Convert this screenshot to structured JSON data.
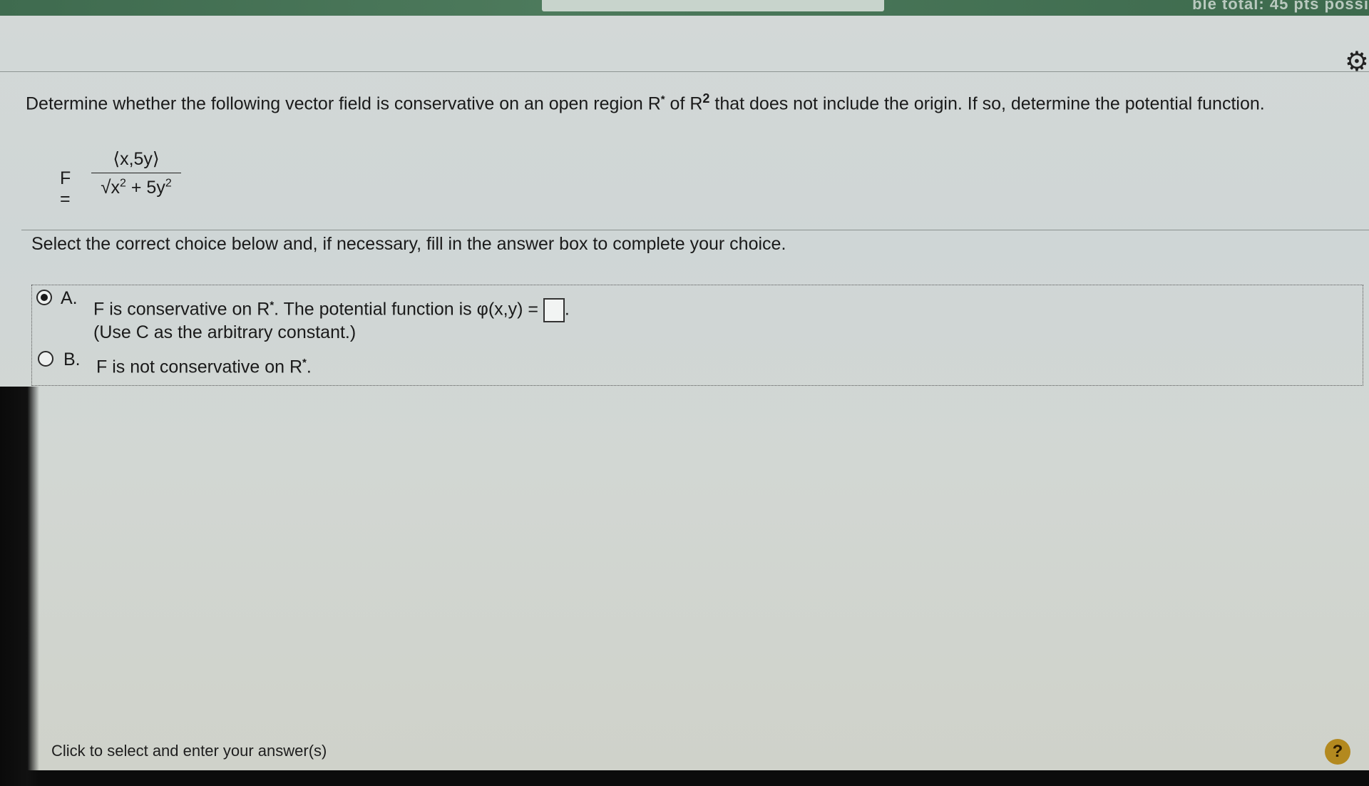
{
  "topbar": {
    "right_text": "ble total: 45 pts possi"
  },
  "question": {
    "part1": "Determine whether the following vector field is conservative on an open region R",
    "part1_sup": "*",
    "part2": " of R",
    "part2_sup": "2",
    "part3": " that does not include the origin. If so, determine the potential function."
  },
  "formula": {
    "label": "F =",
    "numerator": "⟨x,5y⟩",
    "radical": "√",
    "den_x": "x",
    "den_x_exp": "2",
    "den_mid": " + 5y",
    "den_y_exp": "2"
  },
  "instruction": "Select the correct choice below and, if necessary, fill in the answer box to complete your choice.",
  "choices": {
    "a": {
      "letter": "A.",
      "text1": "F is conservative on R",
      "sup": "*",
      "text2": ". The potential function is φ(x,y) = ",
      "text3": ".",
      "note": "(Use C as the arbitrary constant.)",
      "selected": true
    },
    "b": {
      "letter": "B.",
      "text1": "F is not conservative on R",
      "sup": "*",
      "text2": ".",
      "selected": false
    }
  },
  "footer": "Click to select and enter your answer(s)",
  "help_icon": "?",
  "gear_icon": "⚙"
}
